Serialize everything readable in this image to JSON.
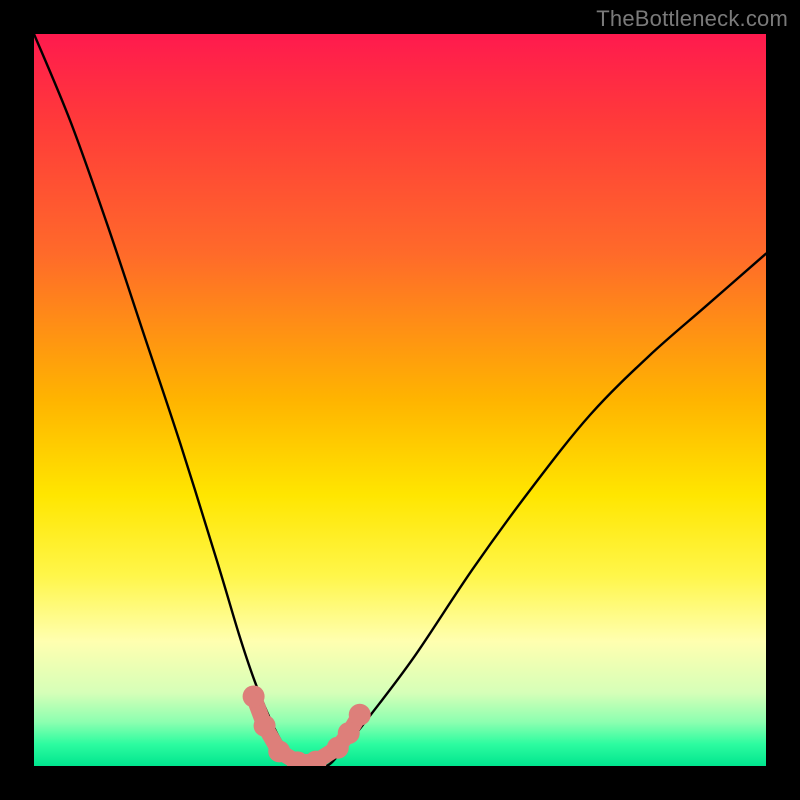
{
  "watermark": "TheBottleneck.com",
  "chart_data": {
    "type": "line",
    "title": "",
    "xlabel": "",
    "ylabel": "",
    "xlim": [
      0,
      100
    ],
    "ylim": [
      0,
      100
    ],
    "series": [
      {
        "name": "bottleneck-v-curve",
        "x": [
          0,
          5,
          10,
          15,
          20,
          25,
          28,
          30,
          32,
          34,
          36,
          38,
          40,
          42,
          46,
          52,
          60,
          68,
          76,
          84,
          92,
          100
        ],
        "y": [
          100,
          88,
          74,
          59,
          44,
          28,
          18,
          12,
          7,
          3,
          1,
          0,
          0,
          2,
          7,
          15,
          27,
          38,
          48,
          56,
          63,
          70
        ]
      },
      {
        "name": "trough-markers",
        "x": [
          30.0,
          31.5,
          33.5,
          36.0,
          38.5,
          41.5,
          43.0,
          44.5
        ],
        "y": [
          9.5,
          5.5,
          2.0,
          0.5,
          0.6,
          2.5,
          4.5,
          7.0
        ]
      }
    ],
    "colors": {
      "curve": "#000000",
      "markers": "#dd7f7a"
    }
  }
}
